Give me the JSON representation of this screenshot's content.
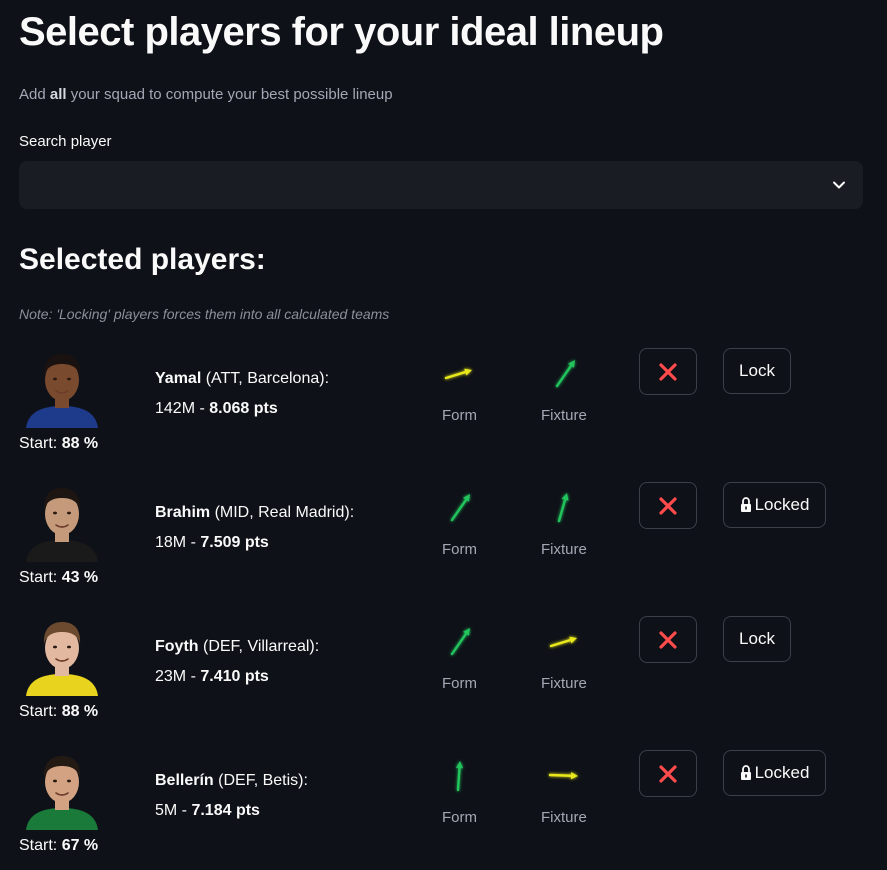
{
  "header": {
    "title": "Select players for your ideal lineup",
    "subtitle_prefix": "Add ",
    "subtitle_bold": "all",
    "subtitle_suffix": " your squad to compute your best possible lineup"
  },
  "search": {
    "label": "Search player",
    "value": "",
    "placeholder": ""
  },
  "selected": {
    "title": "Selected players:",
    "note": "Note: 'Locking' players forces them into all calculated teams"
  },
  "labels": {
    "form": "Form",
    "fixture": "Fixture",
    "start_prefix": "Start: ",
    "price_separator": " - ",
    "remove_icon": "×"
  },
  "colors": {
    "background": "#0e1117",
    "remove_red": "#ff4b4b",
    "arrow_green": "#21c55d",
    "arrow_yellow": "#e8e81c"
  },
  "players": [
    {
      "name": "Yamal",
      "details": " (ATT, Barcelona):",
      "price": "142M",
      "points": "8.068 pts",
      "start": "88 %",
      "form_arrow": "yellow-up-right-slight",
      "fixture_arrow": "green-up-right-steep",
      "lock_label": "Lock",
      "locked": false,
      "photo_icon": "player-photo-icon",
      "skin": "#7a4a2e",
      "hair": "#1a1210",
      "shirt": "#1e3a8a"
    },
    {
      "name": "Brahim",
      "details": " (MID, Real Madrid):",
      "price": "18M",
      "points": "7.509 pts",
      "start": "43 %",
      "form_arrow": "green-up-right-steep",
      "fixture_arrow": "green-up-steep",
      "lock_label": "Locked",
      "locked": true,
      "photo_icon": "player-photo-icon",
      "skin": "#c49a7a",
      "hair": "#1c1512",
      "shirt": "#1a1a1a"
    },
    {
      "name": "Foyth",
      "details": " (DEF, Villarreal):",
      "price": "23M",
      "points": "7.410 pts",
      "start": "88 %",
      "form_arrow": "green-up-right-steep",
      "fixture_arrow": "yellow-up-right-slight",
      "lock_label": "Lock",
      "locked": false,
      "photo_icon": "player-photo-icon",
      "skin": "#e3b8a0",
      "hair": "#6b4a30",
      "shirt": "#e8d31e"
    },
    {
      "name": "Bellerín",
      "details": " (DEF, Betis):",
      "price": "5M",
      "points": "7.184 pts",
      "start": "67 %",
      "form_arrow": "green-up",
      "fixture_arrow": "yellow-right",
      "lock_label": "Locked",
      "locked": true,
      "photo_icon": "player-photo-icon",
      "skin": "#d2a283",
      "hair": "#241a14",
      "shirt": "#1a7a3a"
    }
  ]
}
